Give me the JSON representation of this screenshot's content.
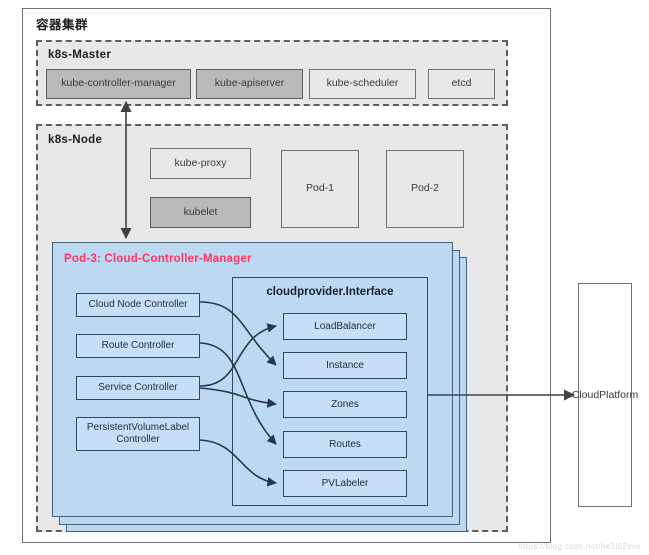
{
  "diagram": {
    "cluster_title": "容器集群",
    "watermark": "https://blog.csdn.net/he1l62mis"
  },
  "master": {
    "title": "k8s-Master",
    "components": [
      {
        "label": "kube-controller-manager",
        "shaded": true
      },
      {
        "label": "kube-apiserver",
        "shaded": true
      },
      {
        "label": "kube-scheduler",
        "shaded": false
      },
      {
        "label": "etcd",
        "shaded": false
      }
    ]
  },
  "node": {
    "title": "k8s-Node",
    "components": [
      {
        "label": "kube-proxy",
        "shaded": false
      },
      {
        "label": "kubelet",
        "shaded": true
      },
      {
        "label": "Pod-1",
        "shaded": false
      },
      {
        "label": "Pod-2",
        "shaded": false
      }
    ]
  },
  "pod3": {
    "title": "Pod-3: Cloud-Controller-Manager",
    "title_color": "#ff3366",
    "panel_color": "#bdd9f2",
    "controllers": [
      {
        "label": "Cloud Node Controller"
      },
      {
        "label": "Route Controller"
      },
      {
        "label": "Service Controller"
      },
      {
        "label": "PersistentVolumeLabel Controller"
      }
    ]
  },
  "interface": {
    "title": "cloudprovider.Interface",
    "methods": [
      {
        "label": "LoadBalancer"
      },
      {
        "label": "Instance"
      },
      {
        "label": "Zones"
      },
      {
        "label": "Routes"
      },
      {
        "label": "PVLabeler"
      }
    ]
  },
  "cloud": {
    "label": "Cloud\nPlatform",
    "line1": "Cloud",
    "line2": "Platform"
  }
}
